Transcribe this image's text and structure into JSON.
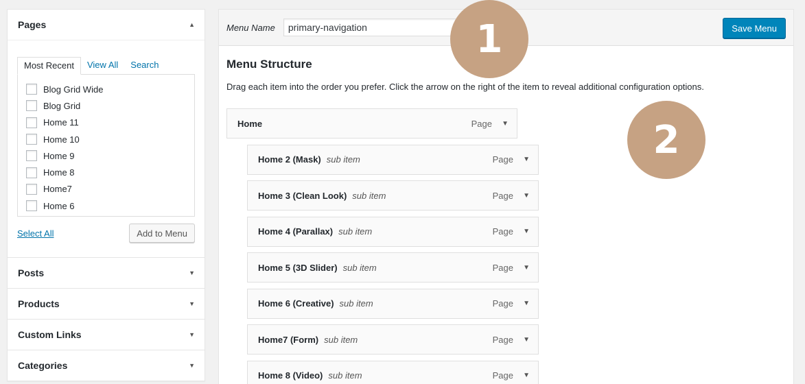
{
  "left": {
    "pages": {
      "title": "Pages",
      "tabs": [
        {
          "label": "Most Recent"
        },
        {
          "label": "View All"
        },
        {
          "label": "Search"
        }
      ],
      "items": [
        {
          "label": "Blog Grid Wide"
        },
        {
          "label": "Blog Grid"
        },
        {
          "label": "Home 11"
        },
        {
          "label": "Home 10"
        },
        {
          "label": "Home 9"
        },
        {
          "label": "Home 8"
        },
        {
          "label": "Home7"
        },
        {
          "label": "Home 6"
        }
      ],
      "select_all": "Select All",
      "add_button": "Add to Menu"
    },
    "boxes": [
      {
        "title": "Posts"
      },
      {
        "title": "Products"
      },
      {
        "title": "Custom Links"
      },
      {
        "title": "Categories"
      }
    ]
  },
  "menu": {
    "name_label": "Menu Name",
    "name_value": "primary-navigation",
    "save_button": "Save Menu",
    "structure_title": "Menu Structure",
    "structure_desc": "Drag each item into the order you prefer. Click the arrow on the right of the item to reveal additional configuration options.",
    "items": [
      {
        "title": "Home",
        "subtype": "",
        "type": "Page"
      },
      {
        "title": "Home 2 (Mask)",
        "subtype": "sub item",
        "type": "Page"
      },
      {
        "title": "Home 3 (Clean Look)",
        "subtype": "sub item",
        "type": "Page"
      },
      {
        "title": "Home 4 (Parallax)",
        "subtype": "sub item",
        "type": "Page"
      },
      {
        "title": "Home 5 (3D Slider)",
        "subtype": "sub item",
        "type": "Page"
      },
      {
        "title": "Home 6 (Creative)",
        "subtype": "sub item",
        "type": "Page"
      },
      {
        "title": "Home7 (Form)",
        "subtype": "sub item",
        "type": "Page"
      },
      {
        "title": "Home 8 (Video)",
        "subtype": "sub item",
        "type": "Page"
      }
    ]
  },
  "badges": [
    "1",
    "2"
  ],
  "colors": {
    "primary": "#0085ba",
    "link": "#0073aa",
    "badge": "#c6a283"
  },
  "icons": {
    "collapse": "triangle-up-icon",
    "expand": "triangle-down-icon"
  }
}
